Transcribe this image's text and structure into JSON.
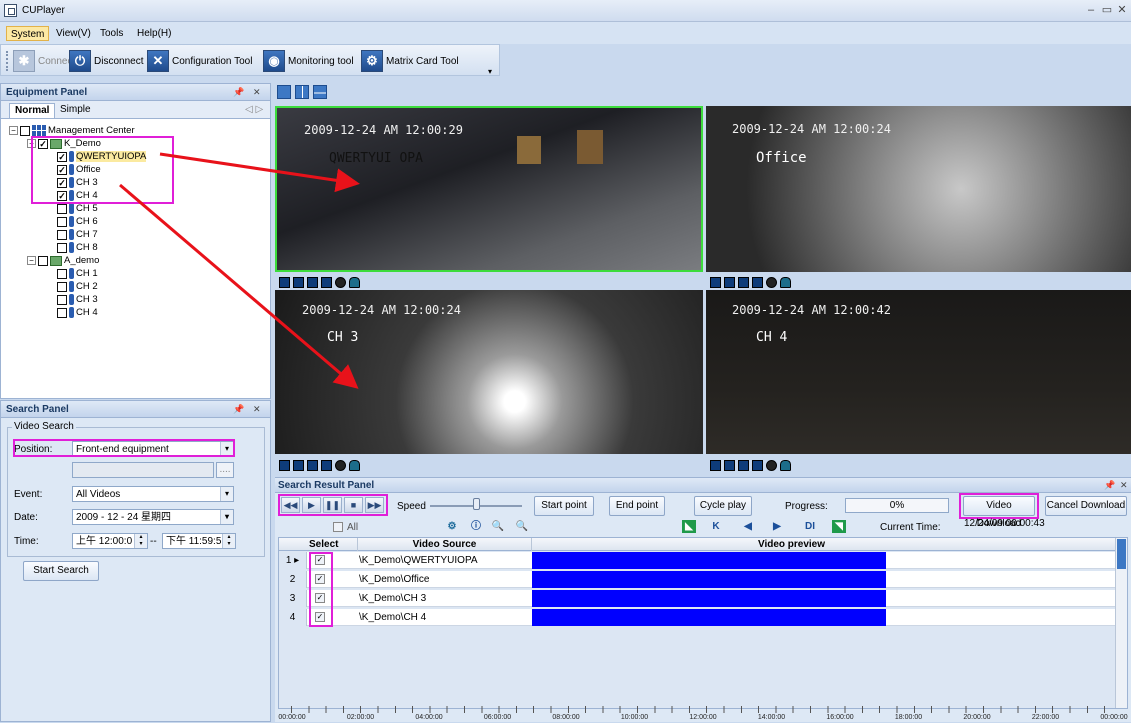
{
  "window": {
    "title": "CUPlayer"
  },
  "menu": [
    "System",
    "View(V)",
    "Tools",
    "Help(H)"
  ],
  "toolbar": {
    "connect": "Connect",
    "disconnect": "Disconnect",
    "config": "Configuration Tool",
    "monitor": "Monitoring tool",
    "matrix": "Matrix Card Tool"
  },
  "equipment_panel": {
    "title": "Equipment Panel",
    "tabs": [
      "Normal",
      "Simple"
    ],
    "root": "Management Center",
    "groups": [
      {
        "name": "K_Demo",
        "channels": [
          "QWERTYUIOPA",
          "Office",
          "CH 3",
          "CH 4",
          "CH 5",
          "CH 6",
          "CH 7",
          "CH 8"
        ],
        "checked": [
          true,
          true,
          true,
          true,
          false,
          false,
          false,
          false
        ]
      },
      {
        "name": "A_demo",
        "channels": [
          "CH 1",
          "CH 2",
          "CH 3",
          "CH 4"
        ],
        "checked": [
          false,
          false,
          false,
          false
        ]
      }
    ]
  },
  "search_panel": {
    "title": "Search Panel",
    "group": "Video Search",
    "position_label": "Position:",
    "position_value": "Front-end equipment",
    "event_label": "Event:",
    "event_value": "All Videos",
    "date_label": "Date:",
    "date_value": "2009 - 12 - 24  星期四",
    "time_label": "Time:",
    "time_from": "上午 12:00:0",
    "time_to": "下午 11:59:5",
    "time_sep": "--",
    "browse": "....",
    "start_button": "Start Search"
  },
  "videos": [
    {
      "timestamp": "2009-12-24 AM 12:00:29",
      "name": "QWERTYUI OPA"
    },
    {
      "timestamp": "2009-12-24 AM 12:00:24",
      "name": "Office"
    },
    {
      "timestamp": "2009-12-24 AM 12:00:24",
      "name": "CH 3"
    },
    {
      "timestamp": "2009-12-24 AM 12:00:42",
      "name": "CH 4"
    }
  ],
  "result_panel": {
    "title": "Search Result Panel",
    "speed_label": "Speed",
    "start_point": "Start point",
    "end_point": "End point",
    "cycle_play": "Cycle play",
    "progress_label": "Progress:",
    "progress_value": "0%",
    "progress": 0,
    "video_download": "Video Download",
    "cancel_download": "Cancel Download",
    "all_label": "All",
    "current_time_label": "Current Time:",
    "current_time": "12/24/09 00:00:43",
    "col_select": "Select",
    "col_source": "Video Source",
    "col_preview": "Video preview",
    "rows": [
      {
        "num": "1",
        "source": "\\K_Demo\\QWERTYUIOPA"
      },
      {
        "num": "2",
        "source": "\\K_Demo\\Office"
      },
      {
        "num": "3",
        "source": "\\K_Demo\\CH 3"
      },
      {
        "num": "4",
        "source": "\\K_Demo\\CH 4"
      }
    ],
    "ruler": [
      "00:00:00",
      "02:00:00",
      "04:00:00",
      "06:00:00",
      "08:00:00",
      "10:00:00",
      "12:00:00",
      "14:00:00",
      "16:00:00",
      "18:00:00",
      "20:00:00",
      "22:00:00",
      "00:00:00"
    ]
  },
  "colors": {
    "highlight": "#e01fd8",
    "arrow": "#e8121a",
    "bar": "#0000ff",
    "active_border": "#3cdc3c"
  }
}
